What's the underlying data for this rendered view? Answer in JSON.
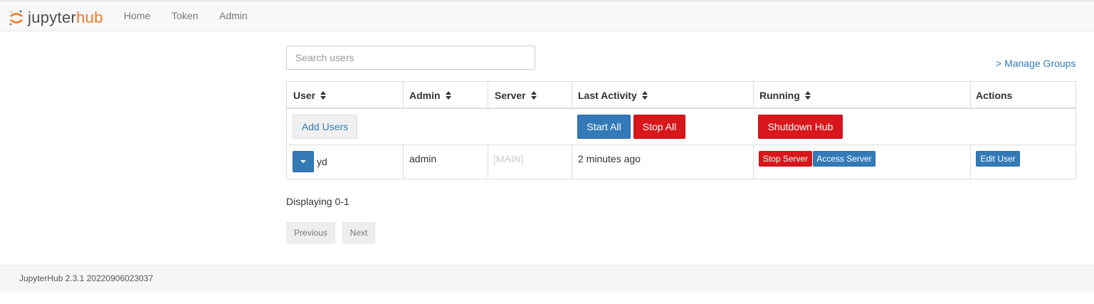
{
  "nav": {
    "brand": {
      "jupyter": "jupyter",
      "hub": "hub"
    },
    "links": [
      "Home",
      "Token",
      "Admin"
    ]
  },
  "search": {
    "placeholder": "Search users"
  },
  "manage_groups": "> Manage Groups",
  "table": {
    "headers": [
      "User",
      "Admin",
      "Server",
      "Last Activity",
      "Running",
      "Actions"
    ],
    "controls": {
      "add_users": "Add Users",
      "start_all": "Start All",
      "stop_all": "Stop All",
      "shutdown_hub": "Shutdown Hub"
    },
    "rows": [
      {
        "user": "yd",
        "admin": "admin",
        "server": "[MAIN]",
        "last_activity": "2 minutes ago",
        "stop_server": "Stop Server",
        "access_server": "Access Server",
        "edit_user": "Edit User"
      }
    ]
  },
  "pagination": {
    "displaying": "Displaying 0-1",
    "previous": "Previous",
    "next": "Next"
  },
  "footer": {
    "version": "JupyterHub 2.3.1 20220906023037"
  },
  "colors": {
    "primary": "#337ab7",
    "danger": "#d9161b",
    "brand": "#f37726"
  }
}
